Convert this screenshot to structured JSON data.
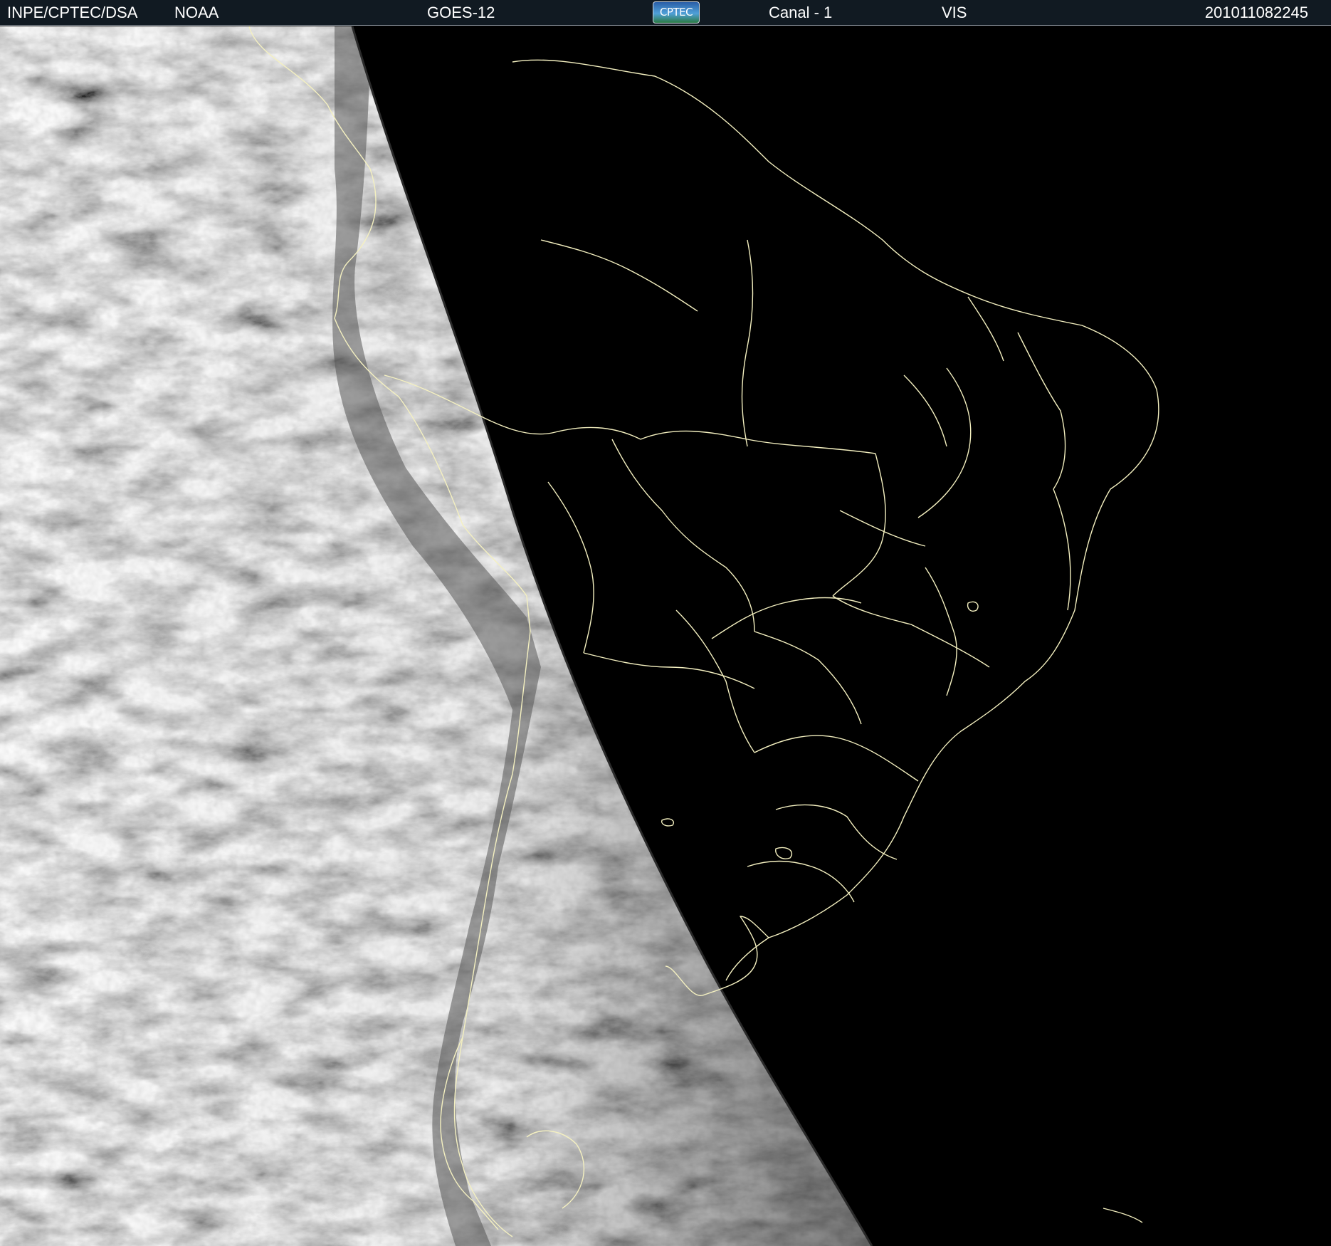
{
  "header": {
    "agency": "INPE/CPTEC/DSA",
    "provider": "NOAA",
    "satellite": "GOES-12",
    "logo_text": "CPTEC",
    "channel": "Canal - 1",
    "band": "VIS",
    "timestamp": "201011082245"
  },
  "colors": {
    "header_background": "#111a22",
    "header_text": "#ffffff",
    "space_background": "#000000",
    "border_lines": "#f4f0c0",
    "cloud_bright": "#e6e6e6",
    "cloud_dark": "#555555"
  },
  "icons": {
    "logo": "cptec-logo"
  }
}
